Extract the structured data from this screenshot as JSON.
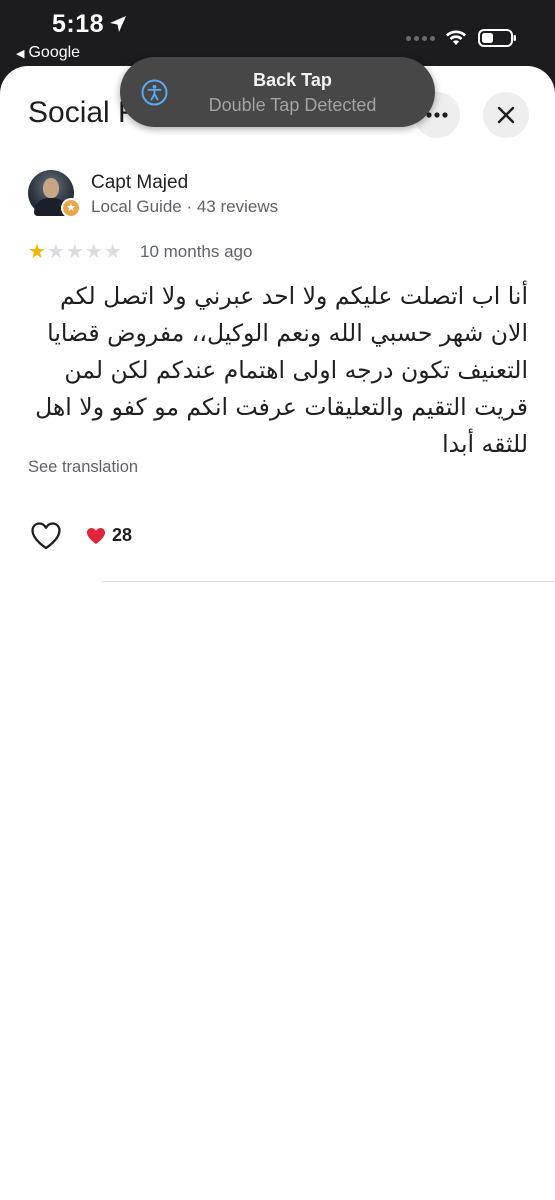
{
  "status_bar": {
    "time": "5:18",
    "back_app": "Google",
    "icons": [
      "location-arrow-icon",
      "cellular-dots-icon",
      "wifi-icon",
      "battery-icon"
    ]
  },
  "sheet": {
    "title": "Social F",
    "more_icon": "more-horizontal-icon",
    "close_icon": "close-icon"
  },
  "banner": {
    "title": "Back Tap",
    "subtitle": "Double Tap Detected",
    "icon": "accessibility-icon",
    "accent_color": "#5aa8f0"
  },
  "review": {
    "reviewer_name": "Capt Majed",
    "reviewer_meta": "Local Guide · 43 reviews",
    "rating": 1,
    "rating_max": 5,
    "date": "10 months ago",
    "text": "أنا اب اتصلت عليكم ولا احد عبرني ولا اتصل لكم الان شهر حسبي الله ونعم الوكيل،، مفروض قضايا التعنيف تكون درجه اولى اهتمام عندكم لكن لمن قريت التقيم والتعليقات عرفت انكم مو كفو ولا اهل للثقه أبدا",
    "see_translation": "See translation",
    "reaction_count": "28",
    "star_color": "#f4b400"
  }
}
